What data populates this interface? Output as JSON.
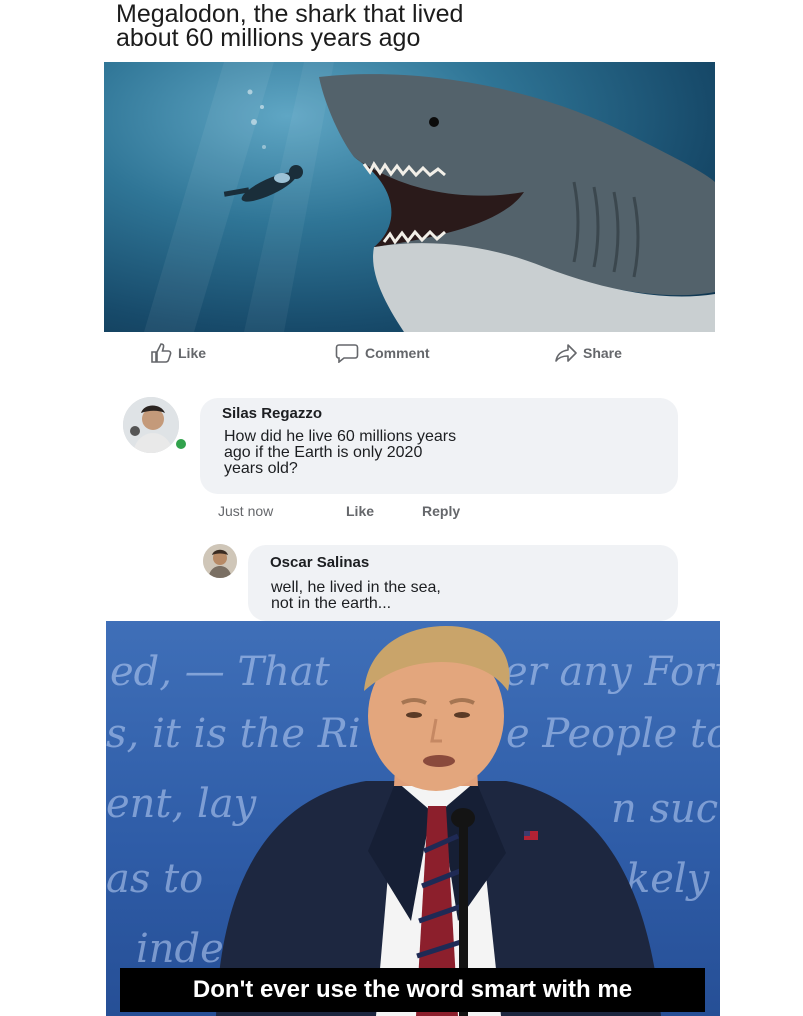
{
  "post": {
    "title_line1": "Megalodon, the shark that lived",
    "title_line2": "about 60 millions years ago"
  },
  "actions": {
    "like": "Like",
    "comment": "Comment",
    "share": "Share"
  },
  "comments": [
    {
      "name": "Silas Regazzo",
      "line1": "How did he live 60 millions years",
      "line2": "ago if the Earth is only 2020",
      "line3": "years old?",
      "time": "Just now",
      "like": "Like",
      "reply": "Reply"
    },
    {
      "name": "Oscar Salinas",
      "line1": "well, he lived in the sea,",
      "line2": "not in the earth..."
    }
  ],
  "meme": {
    "background_script": [
      "ed,  —  That",
      "er  any Form",
      "s, it is the Ri",
      "e People to",
      "ent, lay",
      "n such",
      "as to",
      "kely",
      "inde"
    ],
    "caption": "Don't ever use the word smart with me"
  },
  "colors": {
    "action_gray": "#65676b",
    "bubble": "#f0f2f5",
    "online": "#31a24c",
    "backdrop_blue": "#2f5da8"
  }
}
